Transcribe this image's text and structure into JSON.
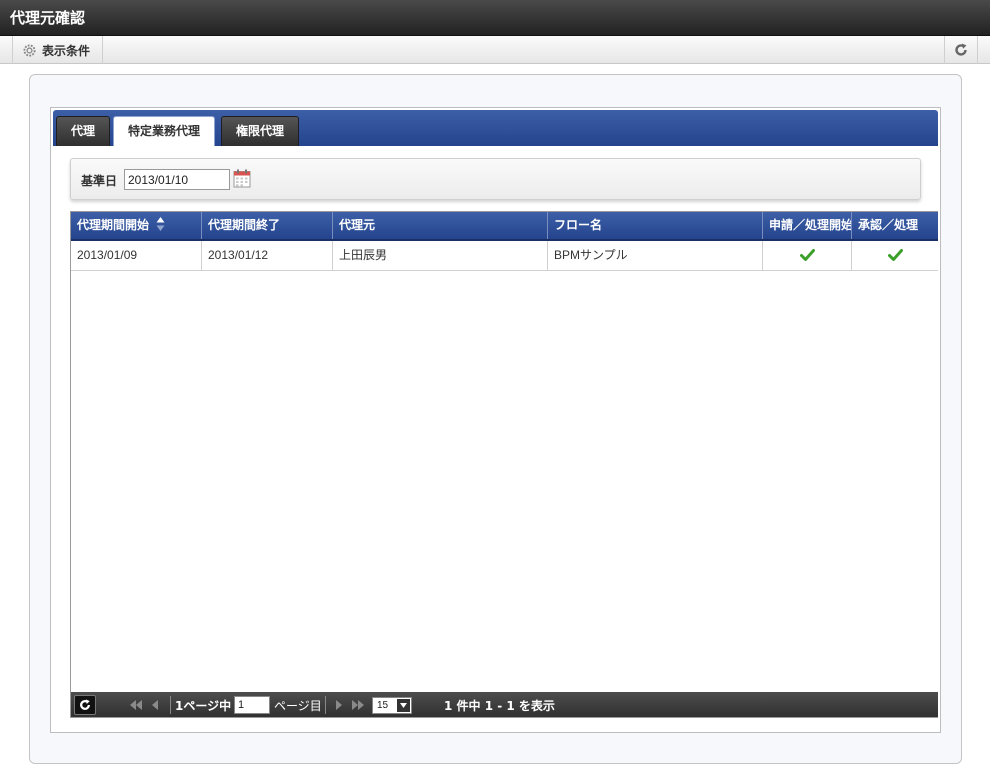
{
  "window": {
    "title": "代理元確認"
  },
  "toolbar": {
    "conditions_label": "表示条件"
  },
  "tabs": [
    {
      "label": "代理",
      "active": false
    },
    {
      "label": "特定業務代理",
      "active": true
    },
    {
      "label": "権限代理",
      "active": false
    }
  ],
  "filter": {
    "label": "基準日",
    "value": "2013/01/10"
  },
  "grid": {
    "columns": [
      "代理期間開始",
      "代理期間終了",
      "代理元",
      "フロー名",
      "申請／処理開始",
      "承認／処理"
    ],
    "sort_column": "代理期間開始",
    "rows": [
      {
        "start": "2013/01/09",
        "end": "2013/01/12",
        "source": "上田辰男",
        "flow": "BPMサンプル",
        "apply": true,
        "approve": true
      }
    ]
  },
  "pager": {
    "page_prefix": "1ページ中",
    "page_value": "1",
    "page_suffix": "ページ目",
    "page_size": "15",
    "summary": "1 件中 1 - 1 を表示"
  },
  "colors": {
    "header_blue": "#2f4f99",
    "dark_bar": "#2f2f2f",
    "check_green": "#3aa02a"
  }
}
